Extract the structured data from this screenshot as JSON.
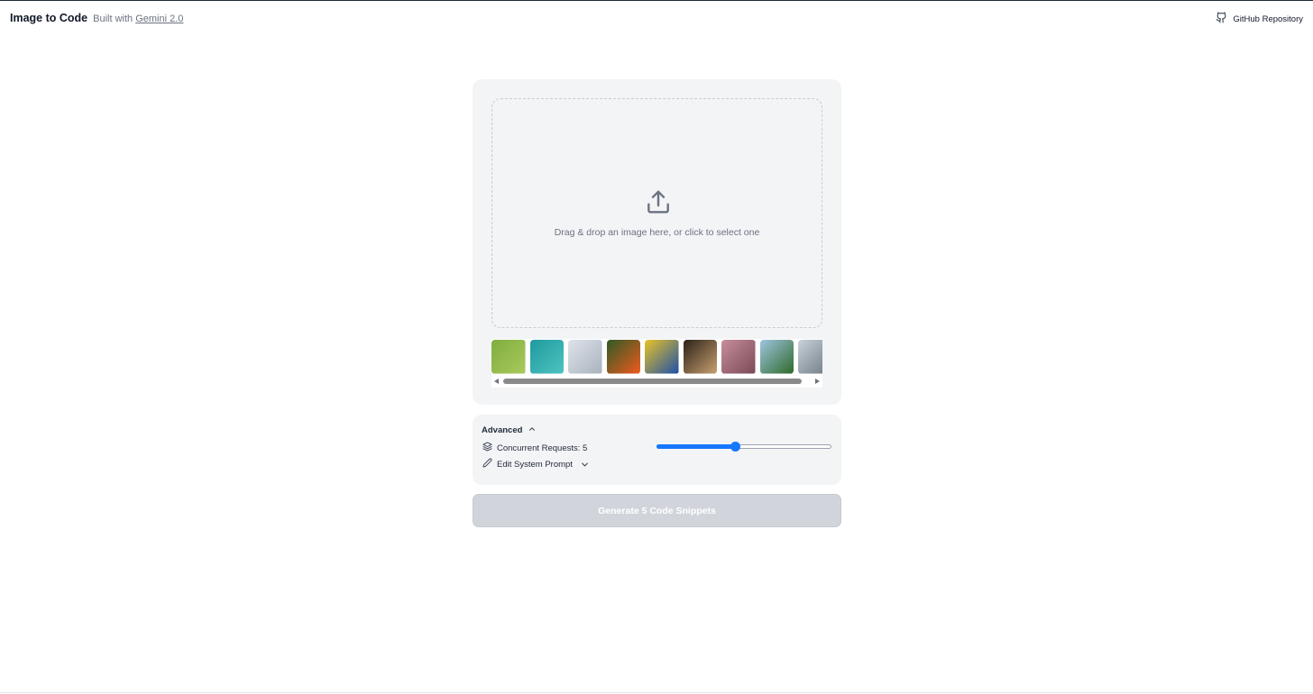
{
  "header": {
    "app_title": "Image to Code",
    "built_with_prefix": "Built with",
    "built_with_link": "Gemini 2.0",
    "github_label": "GitHub Repository"
  },
  "upload": {
    "drop_text": "Drag & drop an image here, or click to select one",
    "examples": [
      {
        "name": "example-green-texture",
        "colors": [
          "#7fae3e",
          "#a9c95c"
        ]
      },
      {
        "name": "example-turquoise-water",
        "colors": [
          "#1f9aa0",
          "#4fc3c0"
        ]
      },
      {
        "name": "example-building",
        "colors": [
          "#dfe3ea",
          "#a9b3bd"
        ]
      },
      {
        "name": "example-orange-flower",
        "colors": [
          "#2f5a25",
          "#ef5a1d"
        ]
      },
      {
        "name": "example-yellow-blue-wall",
        "colors": [
          "#e8c426",
          "#1e4fa8"
        ]
      },
      {
        "name": "example-lamp-dark",
        "colors": [
          "#2c2218",
          "#c8a070"
        ]
      },
      {
        "name": "example-pink-sky",
        "colors": [
          "#c78e9a",
          "#7a4a58"
        ]
      },
      {
        "name": "example-tree",
        "colors": [
          "#9fc4e0",
          "#2e6a2a"
        ]
      },
      {
        "name": "example-gray-sky",
        "colors": [
          "#c9d2da",
          "#6b7680"
        ]
      }
    ],
    "scroll_position": 0.0
  },
  "advanced": {
    "label": "Advanced",
    "concurrent_label": "Concurrent Requests: 5",
    "concurrent_value": 5,
    "concurrent_min": 1,
    "concurrent_max": 10,
    "edit_prompt_label": "Edit System Prompt"
  },
  "generate": {
    "label": "Generate 5 Code Snippets",
    "enabled": false
  },
  "colors": {
    "accent": "#1677ff",
    "card_bg": "#f3f4f6",
    "button_disabled": "#d1d5db"
  }
}
